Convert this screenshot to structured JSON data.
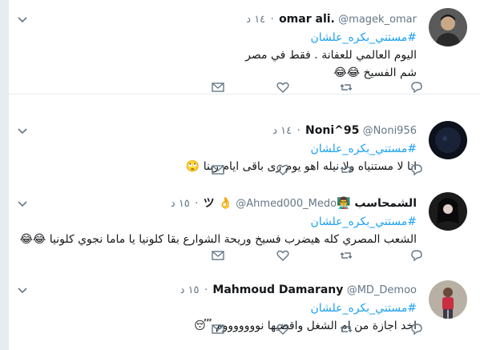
{
  "tweets": [
    {
      "name": "omar ali.",
      "handle": "@magek_omar",
      "time": "١٤ د",
      "hashtag": "#مستني_بكره_علشان",
      "lines": [
        "اليوم العالمي للعفانة . فقط في مصر",
        "شم الفسيخ 😂😂"
      ],
      "avatar_color": "#3a3a3a"
    },
    {
      "name": "Noni^95",
      "handle": "@Noni956",
      "time": "١٤ د",
      "hashtag": "#مستني_بكره_علشان",
      "lines": [
        "انا لا مستنياه ولا نيله اهو يوم زى باقى ايام ربنا 🙄"
      ],
      "avatar_color": "#1a1f2e"
    },
    {
      "name": "الشمحاسب 👨‍🏫ツ 👌",
      "handle": "@Ahmed000_Medo",
      "time": "١٥ د",
      "hashtag": "#مستني_بكره_علشان",
      "lines": [
        "الشعب المصري كله هيضرب فسيخ وريحة الشوارع بقا كلونيا يا ماما نجوي كلونيا 😂😂"
      ],
      "avatar_color": "#222222"
    },
    {
      "name": "Mahmoud Damarany",
      "handle": "@MD_Demoo",
      "time": "١٥ د",
      "hashtag": "#مستني_بكره_علشان",
      "lines": [
        "اخد اجازة من ام الشغل واقضيها نوووووووم 😴"
      ],
      "avatar_color": "#8a7a6a"
    }
  ],
  "icons": {
    "reply": "reply-icon",
    "retweet": "retweet-icon",
    "like": "heart-icon",
    "dm": "envelope-icon",
    "more": "chevron-down-icon"
  },
  "colors": {
    "link": "#1da1f2",
    "muted": "#657786",
    "text": "#14171a",
    "border": "#e6ecf0"
  }
}
